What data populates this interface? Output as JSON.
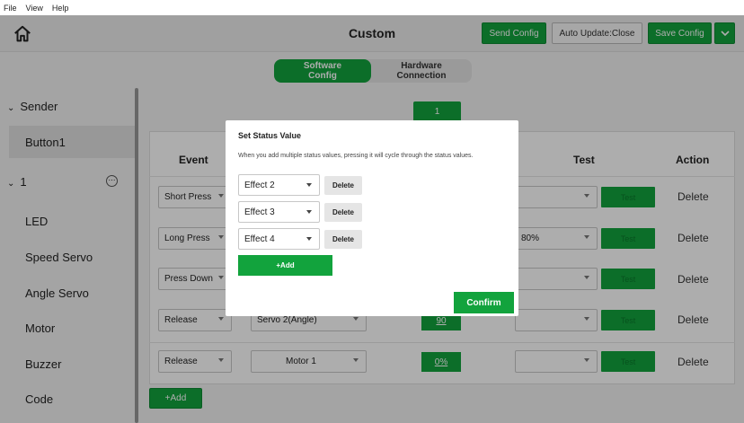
{
  "menubar": {
    "items": [
      "File",
      "View",
      "Help"
    ]
  },
  "header": {
    "title": "Custom",
    "send_label": "Send Config",
    "auto_label": "Auto Update:Close",
    "save_label": "Save Config"
  },
  "tabs": {
    "software": [
      "Software",
      "Config"
    ],
    "hardware": [
      "Hardware",
      "Connection"
    ]
  },
  "sidebar": {
    "sender": "Sender",
    "button1": "Button1",
    "group": "1",
    "items": [
      "LED",
      "Speed Servo",
      "Angle Servo",
      "Motor",
      "Buzzer",
      "Code"
    ]
  },
  "main": {
    "channel": "1",
    "headers": {
      "event": "Event",
      "test": "Test",
      "action": "Action"
    },
    "rows": [
      {
        "event": "Short Press",
        "device": "",
        "value": "",
        "test_value": "",
        "test": "Test",
        "action": "Delete"
      },
      {
        "event": "Long Press",
        "device": "",
        "value": "",
        "test_value": "80%",
        "test": "Test",
        "action": "Delete"
      },
      {
        "event": "Press Down",
        "device": "",
        "value": "",
        "test_value": "",
        "test": "Test",
        "action": "Delete"
      },
      {
        "event": "Release",
        "device": "Servo 2(Angle)",
        "value": "90",
        "test_value": "",
        "test": "Test",
        "action": "Delete"
      },
      {
        "event": "Release",
        "device": "Motor 1",
        "value": "0%",
        "test_value": "",
        "test": "Test",
        "action": "Delete"
      }
    ],
    "add_label": "+Add"
  },
  "dialog": {
    "title": "Set Status Value",
    "description": "When you add multiple status values, pressing it will cycle through the status values.",
    "effects": [
      {
        "value": "Effect 2",
        "delete": "Delete"
      },
      {
        "value": "Effect 3",
        "delete": "Delete"
      },
      {
        "value": "Effect 4",
        "delete": "Delete"
      }
    ],
    "add_label": "+Add",
    "confirm_label": "Confirm"
  },
  "colors": {
    "accent": "#12a33d",
    "overlay": "rgba(0,0,0,0.32)"
  }
}
